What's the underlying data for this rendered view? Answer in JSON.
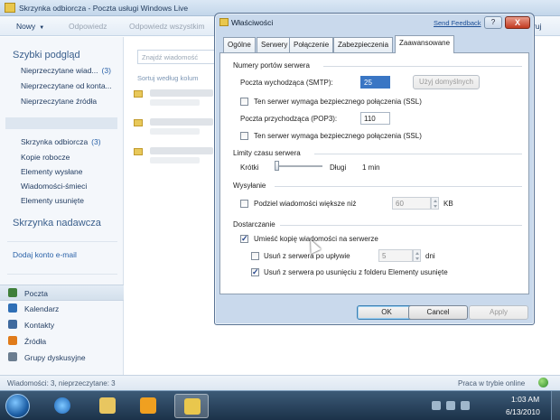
{
  "main_window": {
    "title": "Skrzynka odbiorcza - Poczta usługi Windows Live",
    "toolbar": {
      "new_label": "Nowy",
      "reply_label": "Odpowiedz",
      "reply_all_label": "Odpowiedz wszystkim",
      "signin_label": "ruj"
    },
    "sidebar": {
      "quick_views_title": "Szybki podgląd",
      "quick_views": [
        {
          "label": "Nieprzeczytane wiad...",
          "count": "(3)"
        },
        {
          "label": "Nieprzeczytane od konta..."
        },
        {
          "label": "Nieprzeczytane źródła"
        }
      ],
      "folders": [
        {
          "label": "Skrzynka odbiorcza",
          "count": "(3)"
        },
        {
          "label": "Kopie robocze"
        },
        {
          "label": "Elementy wysłane"
        },
        {
          "label": "Wiadomości-śmieci"
        },
        {
          "label": "Elementy usunięte"
        }
      ],
      "outbox_title": "Skrzynka nadawcza",
      "add_account": "Dodaj konto e-mail",
      "nav": [
        {
          "label": "Poczta",
          "icon": "mail-icon",
          "color": "#3f7f3a"
        },
        {
          "label": "Kalendarz",
          "icon": "calendar-icon",
          "color": "#2f6fb6"
        },
        {
          "label": "Kontakty",
          "icon": "contacts-icon",
          "color": "#3f6a9e"
        },
        {
          "label": "Źródła",
          "icon": "feeds-icon",
          "color": "#e07b1a"
        },
        {
          "label": "Grupy dyskusyjne",
          "icon": "newsgroups-icon",
          "color": "#6b7d90"
        }
      ]
    },
    "list": {
      "search_placeholder": "Znajdź wiadomość",
      "sort_label": "Sortuj według kolum"
    },
    "status": {
      "left": "Wiadomości: 3, nieprzeczytane: 3",
      "right": "Praca w trybie online"
    }
  },
  "dialog": {
    "title": "Właściwości",
    "send_feedback": "Send Feedback",
    "help_label": "?",
    "close_label": "X",
    "tabs": [
      "Ogólne",
      "Serwery",
      "Połączenie",
      "Zabezpieczenia",
      "Zaawansowane"
    ],
    "active_tab": "Zaawansowane",
    "ports": {
      "group": "Numery portów serwera",
      "smtp_label": "Poczta wychodząca (SMTP):",
      "smtp_value": "25",
      "default_button": "Użyj domyślnych",
      "smtp_ssl_label": "Ten serwer wymaga bezpiecznego połączenia (SSL)",
      "pop3_label": "Poczta przychodząca (POP3):",
      "pop3_value": "110",
      "pop3_ssl_label": "Ten serwer wymaga bezpiecznego połączenia (SSL)"
    },
    "timeouts": {
      "group": "Limity czasu serwera",
      "short_label": "Krótki",
      "long_label": "Długi",
      "value": "1 min",
      "slider_level": 0
    },
    "sending": {
      "group": "Wysyłanie",
      "split_label": "Podziel wiadomości większe niż",
      "split_value": "60",
      "unit": "KB",
      "split_checked": false
    },
    "delivery": {
      "group": "Dostarczanie",
      "leave_copy_label": "Umieść kopię wiadomości na serwerze",
      "leave_copy_checked": true,
      "remove_after_label": "Usuń z serwera po upływie",
      "remove_after_value": "5",
      "days_label": "dni",
      "remove_after_checked": false,
      "remove_deleted_label": "Usuń z serwera po usunięciu z folderu Elementy usunięte",
      "remove_deleted_checked": true
    },
    "buttons": {
      "ok": "OK",
      "cancel": "Cancel",
      "apply": "Apply"
    }
  },
  "taskbar": {
    "time": "1:03 AM",
    "date": "6/13/2010"
  }
}
